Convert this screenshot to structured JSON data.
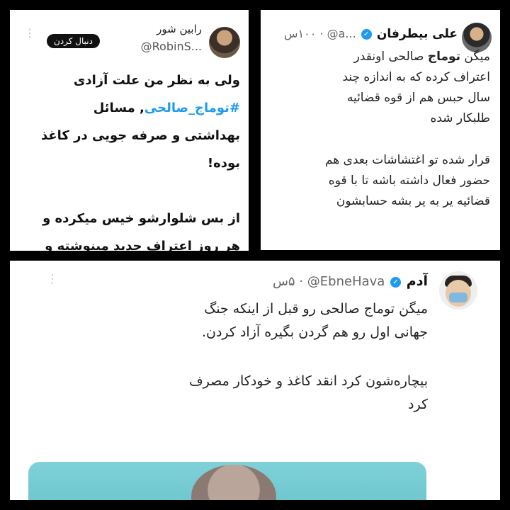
{
  "tweet_top_left": {
    "display_name": "رابین شور",
    "handle": "@RobinS...",
    "follow_label": "دنبال کردن",
    "lines": [
      "ولی به نظر من علت آزادی",
      "#توماج_صالحی, مسائل",
      "بهداشتی و صرفه جویی در کاغذ",
      "بوده!",
      "",
      "از بس شلوارشو خیس میکرده و",
      "هر روز اعتراف جدید مینوشته و"
    ],
    "hashtag": "#توماج_صالحی"
  },
  "tweet_top_right": {
    "display_name": "علی بیطرفان",
    "handle": "@a...",
    "time": "۱۰۰س",
    "paragraph1": [
      "میگن توماج صالحی اونقدر",
      "اعتراف کرده که به اندازه چند",
      "سال حبس هم از قوه قضائیه",
      "طلبکار شده"
    ],
    "paragraph2": [
      "قرار شده تو اغتشاشات بعدی هم",
      "حضور فعال داشته باشه تا با قوه",
      "قضائیه یر به یر بشه حسابشون"
    ]
  },
  "tweet_bottom": {
    "display_name": "آدم",
    "handle": "@EbneHava",
    "time": "۵س",
    "paragraph1": [
      "میگن توماج صالحی رو قبل از اینکه جنگ",
      "جهانی اول رو هم گردن بگیره آزاد کردن."
    ],
    "paragraph2": [
      "بیچاره‌شون کرد انقد کاغذ و خودکار مصرف",
      "کرد"
    ]
  },
  "colors": {
    "accent": "#1d9bf0",
    "follow_bg": "#111111",
    "media_bg": "#7fd1d8"
  }
}
